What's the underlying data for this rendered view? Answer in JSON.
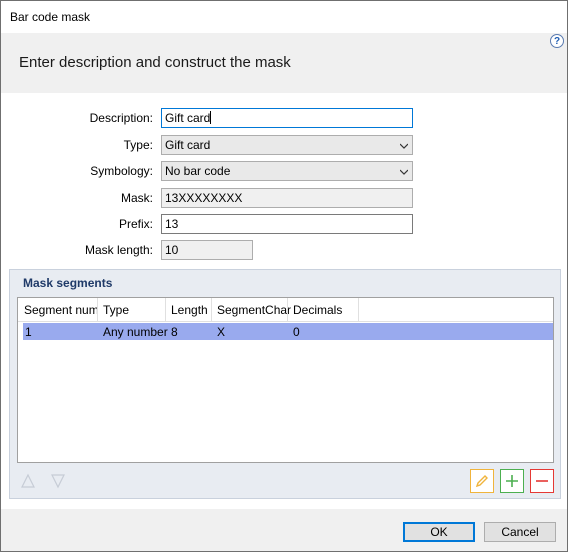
{
  "window": {
    "title": "Bar code mask"
  },
  "header": {
    "title": "Enter description and construct the mask"
  },
  "form": {
    "description": {
      "label": "Description:",
      "value": "Gift card"
    },
    "type": {
      "label": "Type:",
      "value": "Gift card"
    },
    "symbology": {
      "label": "Symbology:",
      "value": "No bar code"
    },
    "mask": {
      "label": "Mask:",
      "value": "13XXXXXXXX"
    },
    "prefix": {
      "label": "Prefix:",
      "value": "13"
    },
    "mask_length": {
      "label": "Mask length:",
      "value": "10"
    }
  },
  "segments": {
    "title": "Mask segments",
    "columns": [
      "Segment num",
      "Type",
      "Length",
      "SegmentChar",
      "Decimals"
    ],
    "rows": [
      [
        "1",
        "Any number",
        "8",
        "X",
        "0"
      ]
    ]
  },
  "icons": {
    "help": "?",
    "move_up": "triangle-up-icon",
    "move_down": "triangle-down-icon",
    "edit": "pencil-icon",
    "add": "plus-icon",
    "remove": "minus-icon"
  },
  "colors": {
    "selected_row": "#99aaee",
    "edit": "#f0b43c",
    "add": "#4caf50",
    "remove": "#e53935",
    "accent": "#0078d7"
  },
  "footer": {
    "ok_label": "OK",
    "cancel_label": "Cancel"
  }
}
